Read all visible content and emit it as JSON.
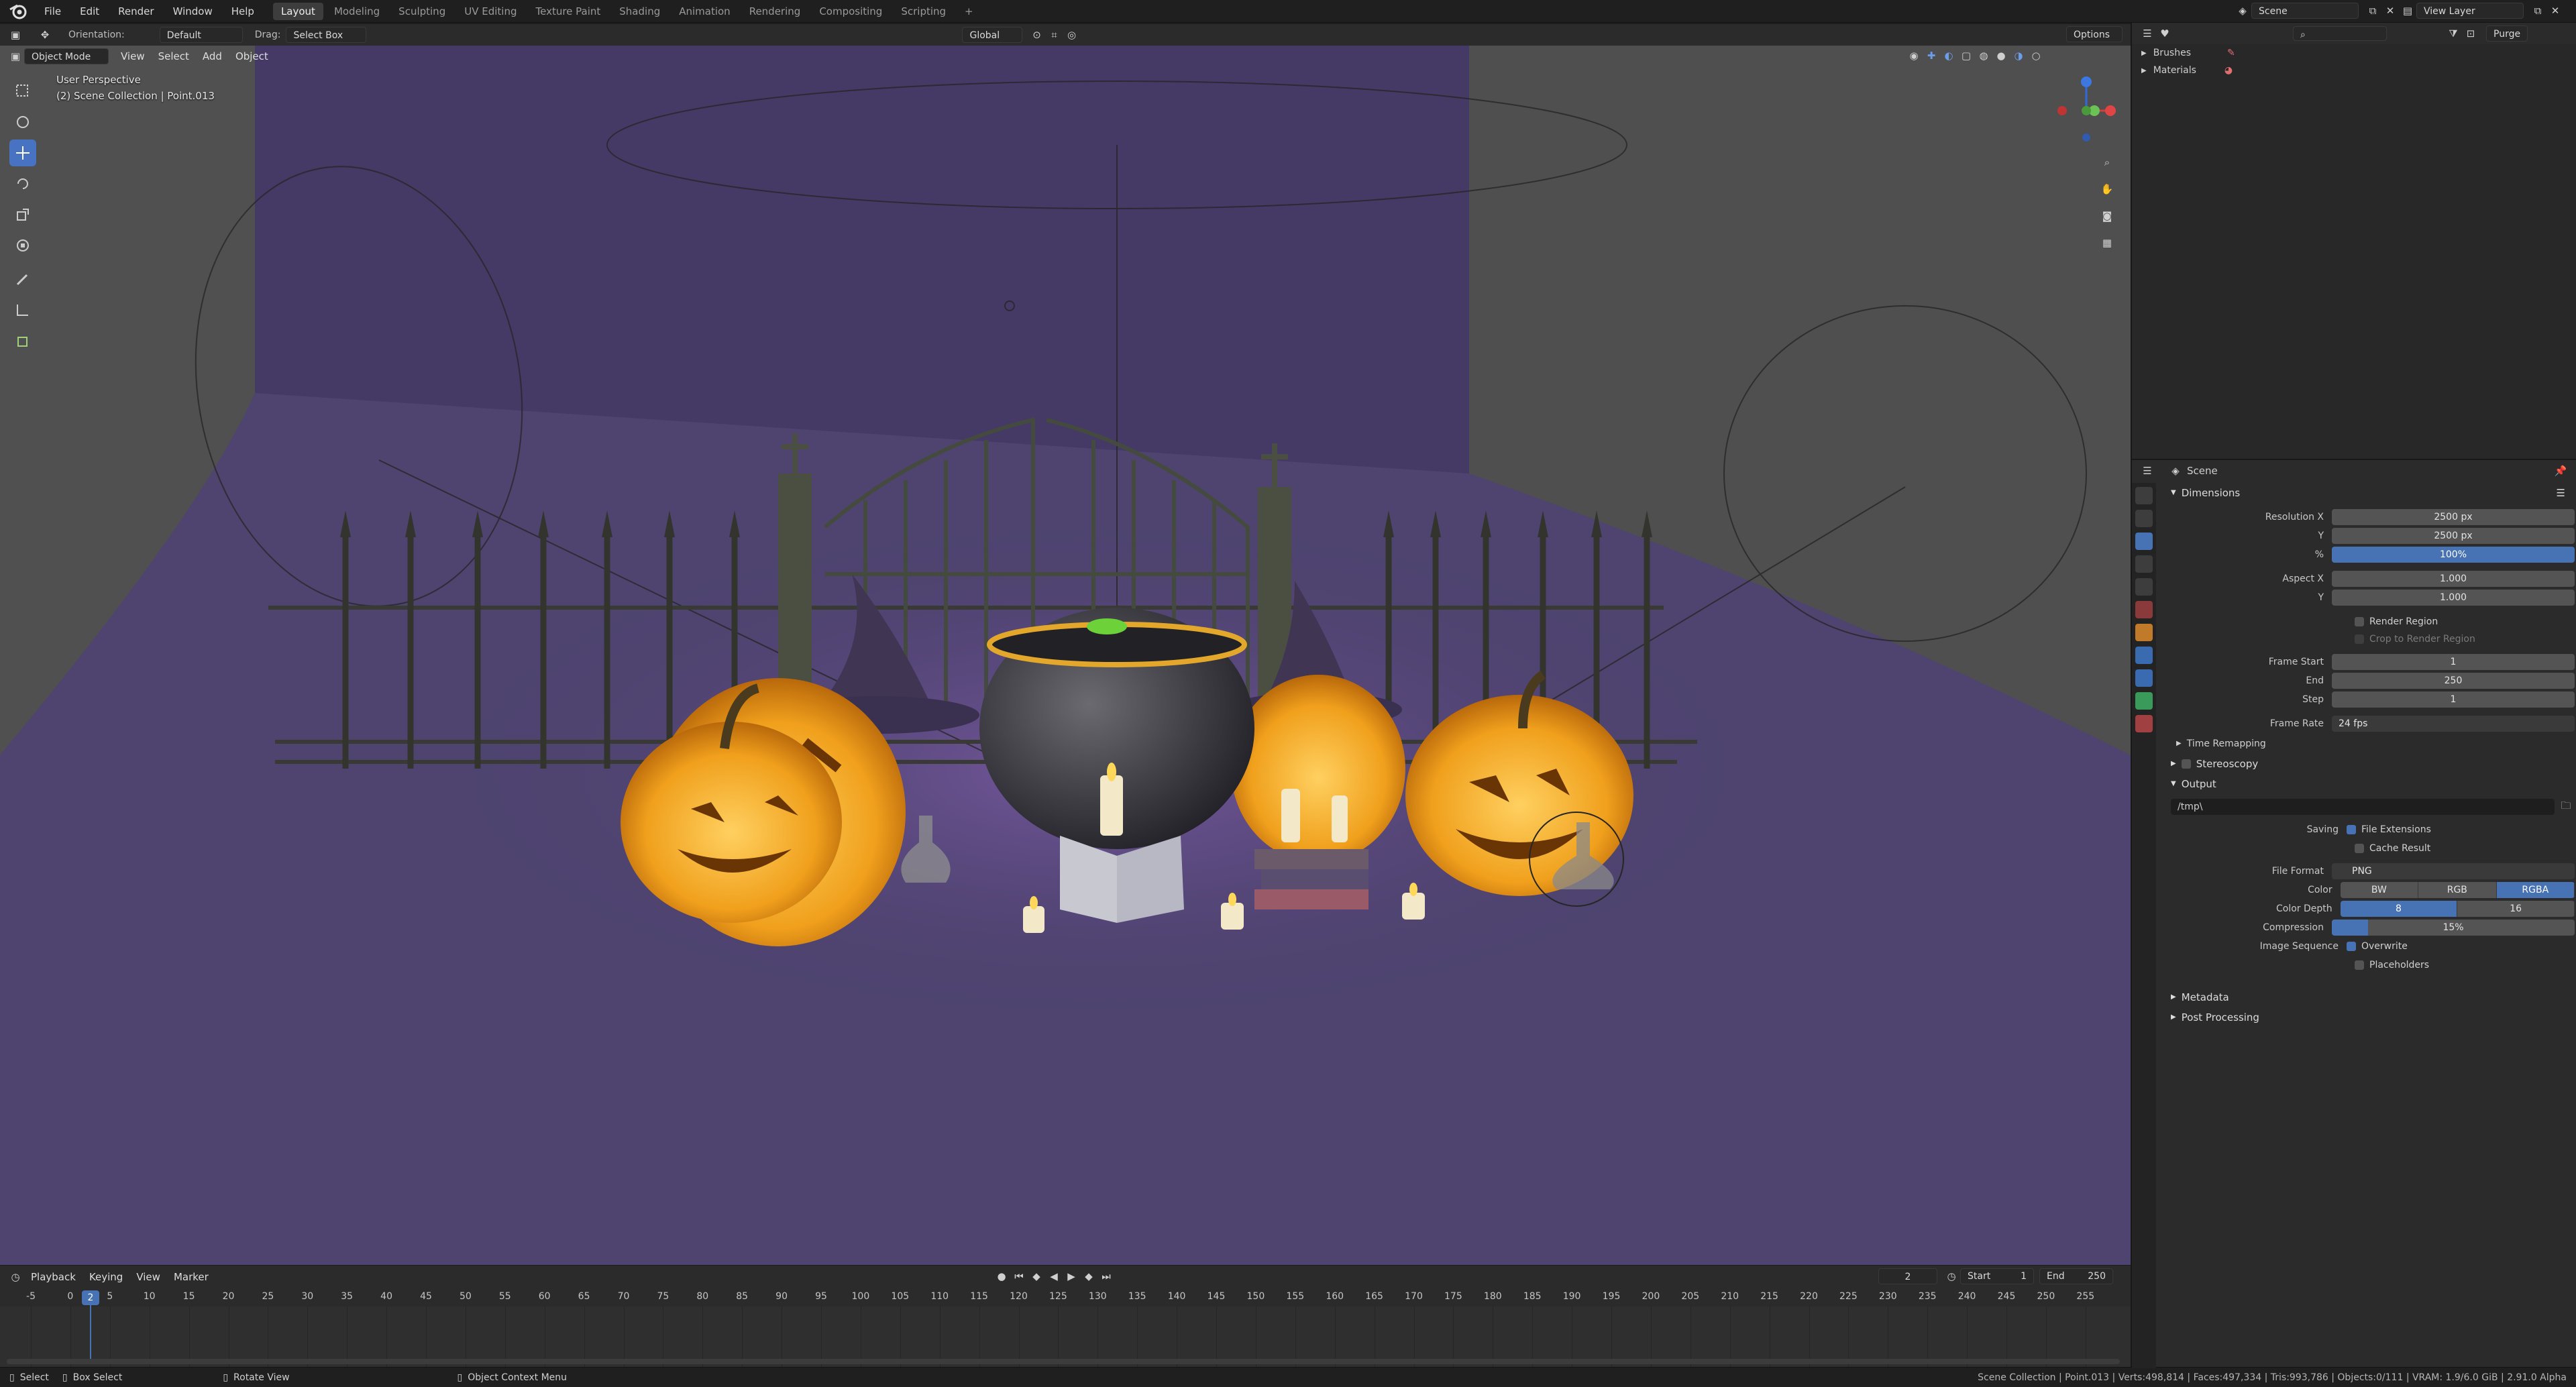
{
  "topbar": {
    "menus": [
      "File",
      "Edit",
      "Render",
      "Window",
      "Help"
    ],
    "workspaces": [
      "Layout",
      "Modeling",
      "Sculpting",
      "UV Editing",
      "Texture Paint",
      "Shading",
      "Animation",
      "Rendering",
      "Compositing",
      "Scripting",
      "+"
    ],
    "active_workspace": "Layout",
    "scene_name": "Scene",
    "view_layer": "View Layer"
  },
  "tool_header": {
    "orientation_label": "Orientation:",
    "orientation_value": "Default",
    "drag_label": "Drag:",
    "drag_value": "Select Box",
    "transform_orientation": "Global",
    "options": "Options"
  },
  "viewport_header": {
    "mode": "Object Mode",
    "menus": [
      "View",
      "Select",
      "Add",
      "Object"
    ]
  },
  "viewport_overlay": {
    "perspective": "User Perspective",
    "collection": "(2) Scene Collection | Point.013"
  },
  "outliner": {
    "purge": "Purge",
    "items": [
      "Brushes",
      "Materials"
    ]
  },
  "properties": {
    "context": "Scene",
    "dimensions": {
      "title": "Dimensions",
      "resolution_x_label": "Resolution X",
      "resolution_x": "2500 px",
      "y_label": "Y",
      "resolution_y": "2500 px",
      "pct_label": "%",
      "resolution_pct": "100%",
      "aspect_x_label": "Aspect X",
      "aspect_x": "1.000",
      "aspect_y_label": "Y",
      "aspect_y": "1.000",
      "render_region": "Render Region",
      "crop_region": "Crop to Render Region",
      "frame_start_label": "Frame Start",
      "frame_start": "1",
      "end_label": "End",
      "frame_end": "250",
      "step_label": "Step",
      "frame_step": "1",
      "frame_rate_label": "Frame Rate",
      "frame_rate": "24 fps",
      "time_remapping": "Time Remapping"
    },
    "stereoscopy": "Stereoscopy",
    "output": {
      "title": "Output",
      "path": "/tmp\\",
      "saving_label": "Saving",
      "file_extensions": "File Extensions",
      "cache_result": "Cache Result",
      "file_format_label": "File Format",
      "file_format": "PNG",
      "color_label": "Color",
      "color_options": [
        "BW",
        "RGB",
        "RGBA"
      ],
      "color_selected": "RGBA",
      "color_depth_label": "Color Depth",
      "color_depth_options": [
        "8",
        "16"
      ],
      "color_depth_selected": "8",
      "compression_label": "Compression",
      "compression": "15%",
      "compression_level": 0.15,
      "image_sequence_label": "Image Sequence",
      "overwrite": "Overwrite",
      "placeholders": "Placeholders"
    },
    "metadata": "Metadata",
    "post_processing": "Post Processing"
  },
  "timeline": {
    "menus": [
      "Playback",
      "Keying",
      "View",
      "Marker"
    ],
    "current_frame": "2",
    "start_label": "Start",
    "start": "1",
    "end_label": "End",
    "end": "250",
    "ruler_ticks": [
      "-5",
      "0",
      "5",
      "10",
      "15",
      "20",
      "25",
      "30",
      "35",
      "40",
      "45",
      "50",
      "55",
      "60",
      "65",
      "70",
      "75",
      "80",
      "85",
      "90",
      "95",
      "100",
      "105",
      "110",
      "115",
      "120",
      "125",
      "130",
      "135",
      "140",
      "145",
      "150",
      "155",
      "160",
      "165",
      "170",
      "175",
      "180",
      "185",
      "190",
      "195",
      "200",
      "205",
      "210",
      "215",
      "220",
      "225",
      "230",
      "235",
      "240",
      "245",
      "250",
      "255"
    ]
  },
  "statusbar": {
    "select": "Select",
    "box_select": "Box Select",
    "rotate_view": "Rotate View",
    "context_menu": "Object Context Menu",
    "stats": "Scene Collection | Point.013 | Verts:498,814 | Faces:497,334 | Tris:993,786 | Objects:0/111 | VRAM: 1.9/6.0 GiB | 2.91.0 Alpha"
  },
  "colors": {
    "accent": "#4772b3",
    "viewport_bg": "#453a66",
    "pumpkin": "#f0a21e"
  }
}
